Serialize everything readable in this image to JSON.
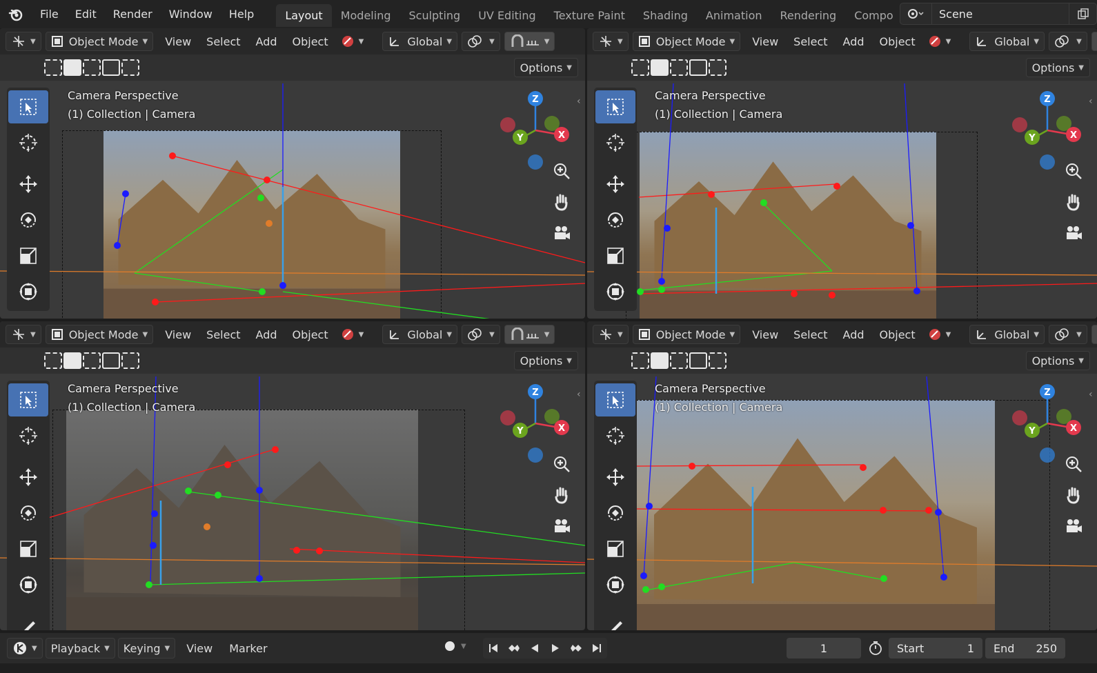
{
  "top_menu": [
    "File",
    "Edit",
    "Render",
    "Window",
    "Help"
  ],
  "workspaces": [
    "Layout",
    "Modeling",
    "Sculpting",
    "UV Editing",
    "Texture Paint",
    "Shading",
    "Animation",
    "Rendering",
    "Compo"
  ],
  "active_workspace": "Layout",
  "scene": {
    "name": "Scene"
  },
  "viewport_header": {
    "mode": "Object Mode",
    "menus": [
      "View",
      "Select",
      "Add",
      "Object"
    ],
    "orientation": "Global",
    "options": "Options"
  },
  "viewports": [
    {
      "title": "Camera Perspective",
      "subtitle": "(1) Collection | Camera"
    },
    {
      "title": "Camera Perspective",
      "subtitle": "(1) Collection | Camera"
    },
    {
      "title": "Camera Perspective",
      "subtitle": "(1) Collection | Camera"
    },
    {
      "title": "Camera Perspective",
      "subtitle": "(1) Collection | Camera"
    }
  ],
  "gizmo_axes": {
    "x": "X",
    "y": "Y",
    "z": "Z"
  },
  "colors": {
    "accent": "#4772b3",
    "axis_x": "#e3394d",
    "axis_y": "#6ba41e",
    "axis_z": "#2f83e0",
    "handle_red": "#ff1a1a",
    "handle_green": "#22dd22",
    "handle_blue": "#1b1bff",
    "horizon": "#e07c2a"
  },
  "timeline": {
    "menus": [
      "Playback",
      "Keying",
      "View",
      "Marker"
    ],
    "current_frame": "1",
    "start_label": "Start",
    "start_value": "1",
    "end_label": "End",
    "end_value": "250"
  }
}
